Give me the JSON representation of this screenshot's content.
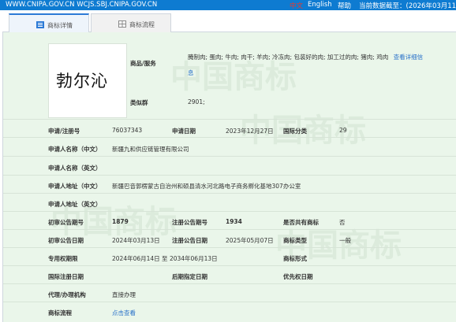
{
  "header": {
    "site_links": "WWW.CNIPA.GOV.CN  WCJS.SBJ.CNIPA.GOV.CN",
    "lang_cn": "中文",
    "lang_en": "English",
    "help": "帮助",
    "data_as_of": "当前数据截至：(2026年03月11日"
  },
  "tabs": [
    {
      "label": "商标详情",
      "active": true,
      "icon": "list-icon"
    },
    {
      "label": "商标流程",
      "active": false,
      "icon": "grid-icon"
    }
  ],
  "watermark": "中国商标",
  "trademark": {
    "logo_text": "勃尔沁",
    "goods_label": "商品/服务",
    "goods_value": "腌制肉; 蛋肉; 牛肉; 肉干; 羊肉; 冷冻肉; 包装好的肉; 加工过的肉; 猪肉; 鸡肉",
    "goods_more": "查看详细信息",
    "group_label": "类似群",
    "group_value": "2901;"
  },
  "fields": {
    "reg_no_label": "申请/注册号",
    "reg_no": "76037343",
    "apply_date_label": "申请日期",
    "apply_date": "2023年12月27日",
    "intl_class_label": "国际分类",
    "intl_class": "29",
    "applicant_cn_label": "申请人名称（中文）",
    "applicant_cn": "新疆九和供应链管理有限公司",
    "applicant_en_label": "申请人名称（英文）",
    "applicant_en": "",
    "address_cn_label": "申请人地址（中文）",
    "address_cn": "新疆巴音郭楞蒙古自治州和硕县清水河北路电子商务孵化基地307办公室",
    "address_en_label": "申请人地址（英文）",
    "address_en": "",
    "prelim_pub_no_label": "初审公告期号",
    "prelim_pub_no": "1879",
    "reg_pub_no_label": "注册公告期号",
    "reg_pub_no": "1934",
    "shared_label": "是否共有商标",
    "shared": "否",
    "prelim_pub_date_label": "初审公告日期",
    "prelim_pub_date": "2024年03月13日",
    "reg_pub_date_label": "注册公告日期",
    "reg_pub_date": "2025年05月07日",
    "tm_type_label": "商标类型",
    "tm_type": "一般",
    "exclusive_period_label": "专用权期限",
    "exclusive_period": "2024年06月14日 至 2034年06月13日",
    "tm_form_label": "商标形式",
    "tm_form": "",
    "intl_reg_date_label": "国际注册日期",
    "intl_reg_date": "",
    "later_designation_label": "后期指定日期",
    "later_designation": "",
    "priority_date_label": "优先权日期",
    "priority_date": "",
    "agent_label": "代理/办理机构",
    "agent": "直接办理",
    "process_label": "商标流程",
    "process_link": "点击查看"
  }
}
